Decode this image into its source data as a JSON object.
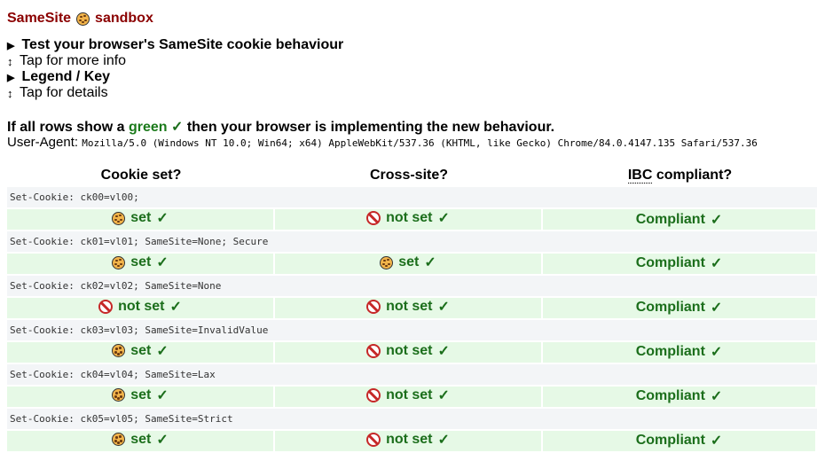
{
  "header": {
    "title_left": "SameSite",
    "title_right": "sandbox",
    "title_icon": "cookie-icon"
  },
  "sections": [
    {
      "summary": "Test your browser's SameSite cookie behaviour",
      "hint": "Tap for more info"
    },
    {
      "summary": "Legend / Key",
      "hint": "Tap for details"
    }
  ],
  "lead": {
    "before": "If all rows show a",
    "green_word": "green",
    "check": "✓",
    "after": "then your browser is implementing the new behaviour."
  },
  "user_agent": {
    "label": "User-Agent:",
    "value": "Mozilla/5.0 (Windows NT 10.0; Win64; x64) AppleWebKit/537.36 (KHTML, like Gecko) Chrome/84.0.4147.135 Safari/537.36"
  },
  "table": {
    "headers": [
      "Cookie set?",
      "Cross-site?",
      "compliant?"
    ],
    "header_abbr": "IBC",
    "rows": [
      {
        "config": "Set-Cookie: ck00=vl00;",
        "cookie_set": "set",
        "cookie_icon": "cookie-icon",
        "cross_site": "not set",
        "cross_icon": "no-entry-icon",
        "compliance": "Compliant",
        "check": "✓"
      },
      {
        "config": "Set-Cookie: ck01=vl01; SameSite=None; Secure",
        "cookie_set": "set",
        "cookie_icon": "cookie-icon",
        "cross_site": "set",
        "cross_icon": "cookie-icon",
        "compliance": "Compliant",
        "check": "✓"
      },
      {
        "config": "Set-Cookie: ck02=vl02; SameSite=None",
        "cookie_set": "not set",
        "cookie_icon": "no-entry-icon",
        "cross_site": "not set",
        "cross_icon": "no-entry-icon",
        "compliance": "Compliant",
        "check": "✓"
      },
      {
        "config": "Set-Cookie: ck03=vl03; SameSite=InvalidValue",
        "cookie_set": "set",
        "cookie_icon": "cookie-icon",
        "cross_site": "not set",
        "cross_icon": "no-entry-icon",
        "compliance": "Compliant",
        "check": "✓"
      },
      {
        "config": "Set-Cookie: ck04=vl04; SameSite=Lax",
        "cookie_set": "set",
        "cookie_icon": "cookie-icon",
        "cross_site": "not set",
        "cross_icon": "no-entry-icon",
        "compliance": "Compliant",
        "check": "✓"
      },
      {
        "config": "Set-Cookie: ck05=vl05; SameSite=Strict",
        "cookie_set": "set",
        "cookie_icon": "cookie-icon",
        "cross_site": "not set",
        "cross_icon": "no-entry-icon",
        "compliance": "Compliant",
        "check": "✓"
      }
    ]
  },
  "colors": {
    "title": "#8b0000",
    "green_text": "#1b6e1b",
    "result_bg": "#e6f9e6",
    "config_bg": "#f3f5f7",
    "no_entry": "#c62828"
  }
}
